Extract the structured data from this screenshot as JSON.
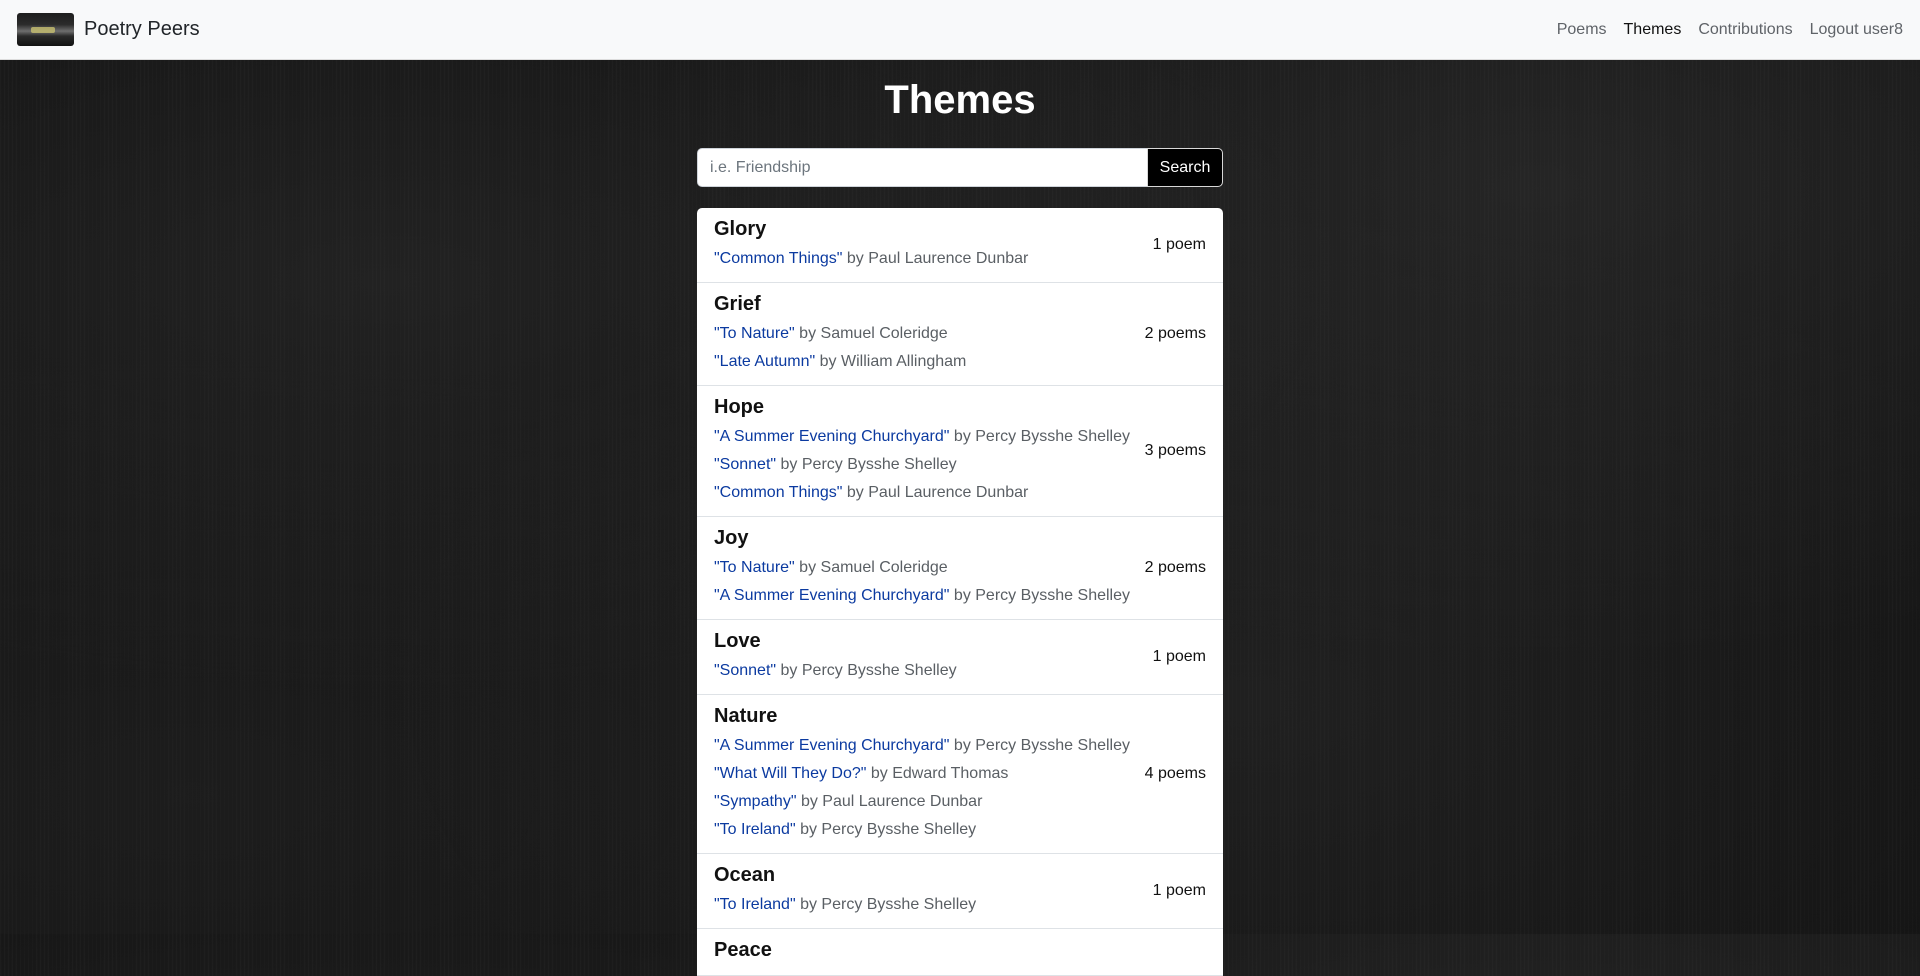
{
  "navbar": {
    "brand": "Poetry Peers",
    "links": [
      {
        "label": "Poems"
      },
      {
        "label": "Themes"
      },
      {
        "label": "Contributions"
      },
      {
        "label": "Logout user8"
      }
    ]
  },
  "page": {
    "title": "Themes"
  },
  "search": {
    "placeholder": "i.e. Friendship",
    "value": "",
    "button_label": "Search"
  },
  "themes": [
    {
      "name": "Glory",
      "count": "1 poem",
      "poems": [
        {
          "title": "\"Common Things\"",
          "by": " by Paul Laurence Dunbar"
        }
      ]
    },
    {
      "name": "Grief",
      "count": "2 poems",
      "poems": [
        {
          "title": "\"To Nature\"",
          "by": " by Samuel Coleridge"
        },
        {
          "title": "\"Late Autumn\"",
          "by": " by William Allingham"
        }
      ]
    },
    {
      "name": "Hope",
      "count": "3 poems",
      "poems": [
        {
          "title": "\"A Summer Evening Churchyard\"",
          "by": " by Percy Bysshe Shelley"
        },
        {
          "title": "\"Sonnet\"",
          "by": " by Percy Bysshe Shelley"
        },
        {
          "title": "\"Common Things\"",
          "by": " by Paul Laurence Dunbar"
        }
      ]
    },
    {
      "name": "Joy",
      "count": "2 poems",
      "poems": [
        {
          "title": "\"To Nature\"",
          "by": " by Samuel Coleridge"
        },
        {
          "title": "\"A Summer Evening Churchyard\"",
          "by": " by Percy Bysshe Shelley"
        }
      ]
    },
    {
      "name": "Love",
      "count": "1 poem",
      "poems": [
        {
          "title": "\"Sonnet\"",
          "by": " by Percy Bysshe Shelley"
        }
      ]
    },
    {
      "name": "Nature",
      "count": "4 poems",
      "poems": [
        {
          "title": "\"A Summer Evening Churchyard\"",
          "by": " by Percy Bysshe Shelley"
        },
        {
          "title": "\"What Will They Do?\"",
          "by": " by Edward Thomas"
        },
        {
          "title": "\"Sympathy\"",
          "by": " by Paul Laurence Dunbar"
        },
        {
          "title": "\"To Ireland\"",
          "by": " by Percy Bysshe Shelley"
        }
      ]
    },
    {
      "name": "Ocean",
      "count": "1 poem",
      "poems": [
        {
          "title": "\"To Ireland\"",
          "by": " by Percy Bysshe Shelley"
        }
      ]
    },
    {
      "name": "Peace",
      "count": "",
      "poems": []
    }
  ]
}
